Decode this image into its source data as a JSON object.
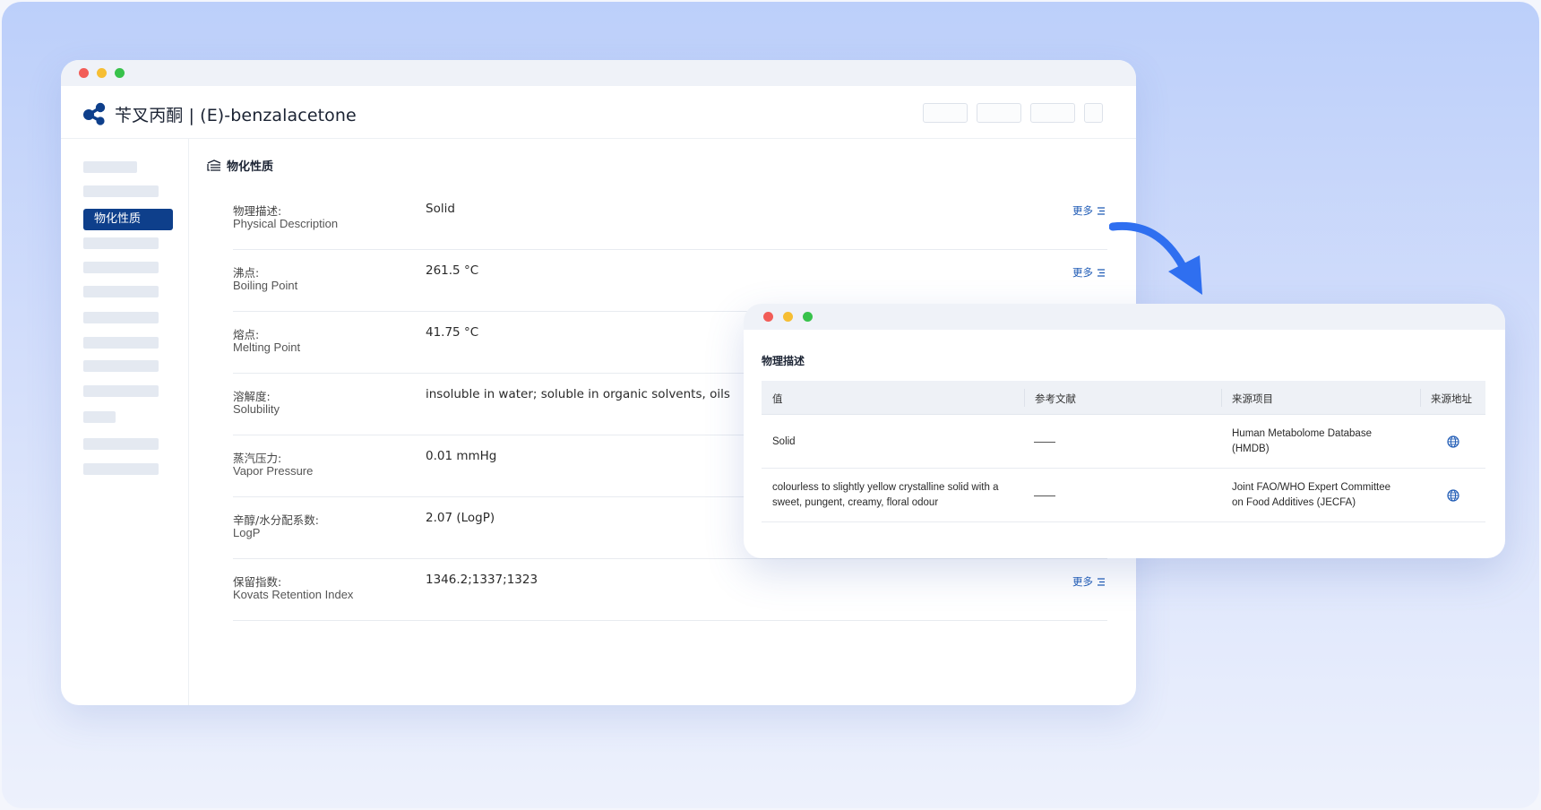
{
  "app": {
    "title": "苄叉丙酮 | (E)-benzalacetone"
  },
  "sidebar": {
    "active_label": "物化性质"
  },
  "section": {
    "title": "物化性质"
  },
  "properties": [
    {
      "cn": "物理描述:",
      "en": "Physical Description",
      "value": "Solid",
      "more": "更多",
      "has_more": true
    },
    {
      "cn": "沸点:",
      "en": "Boiling Point",
      "value": "261.5 °C",
      "more": "更多",
      "has_more": true
    },
    {
      "cn": "熔点:",
      "en": "Melting Point",
      "value": "41.75 °C",
      "more": "",
      "has_more": false
    },
    {
      "cn": "溶解度:",
      "en": "Solubility",
      "value": "insoluble in water; soluble in organic solvents, oils",
      "more": "",
      "has_more": false
    },
    {
      "cn": "蒸汽压力:",
      "en": "Vapor Pressure",
      "value": "0.01 mmHg",
      "more": "",
      "has_more": false
    },
    {
      "cn": "辛醇/水分配系数:",
      "en": "LogP",
      "value": "2.07 (LogP)",
      "more": "",
      "has_more": false
    },
    {
      "cn": "保留指数:",
      "en": "Kovats Retention Index",
      "value": "1346.2;1337;1323",
      "more": "更多",
      "has_more": true
    }
  ],
  "popup": {
    "title": "物理描述",
    "columns": [
      "值",
      "参考文献",
      "来源项目",
      "来源地址"
    ],
    "rows": [
      {
        "value": "Solid",
        "source_line1": "Human Metabolome Database",
        "source_line2": "(HMDB)"
      },
      {
        "value_line1": "colourless to slightly yellow crystalline solid with a",
        "value_line2": "sweet, pungent, creamy, floral odour",
        "source_line1": "Joint FAO/WHO Expert Committee",
        "source_line2": "on Food Additives (JECFA)"
      }
    ]
  },
  "icons": {
    "logo": "molecule-logo-icon",
    "section": "layers-icon",
    "more": "list-icon",
    "link": "globe-icon",
    "arrow": "curved-arrow-icon"
  },
  "colors": {
    "brand": "#0e3f8b",
    "link": "#1f5bb5",
    "arrow": "#2f6ff0",
    "backdrop_top": "#bccffa"
  }
}
